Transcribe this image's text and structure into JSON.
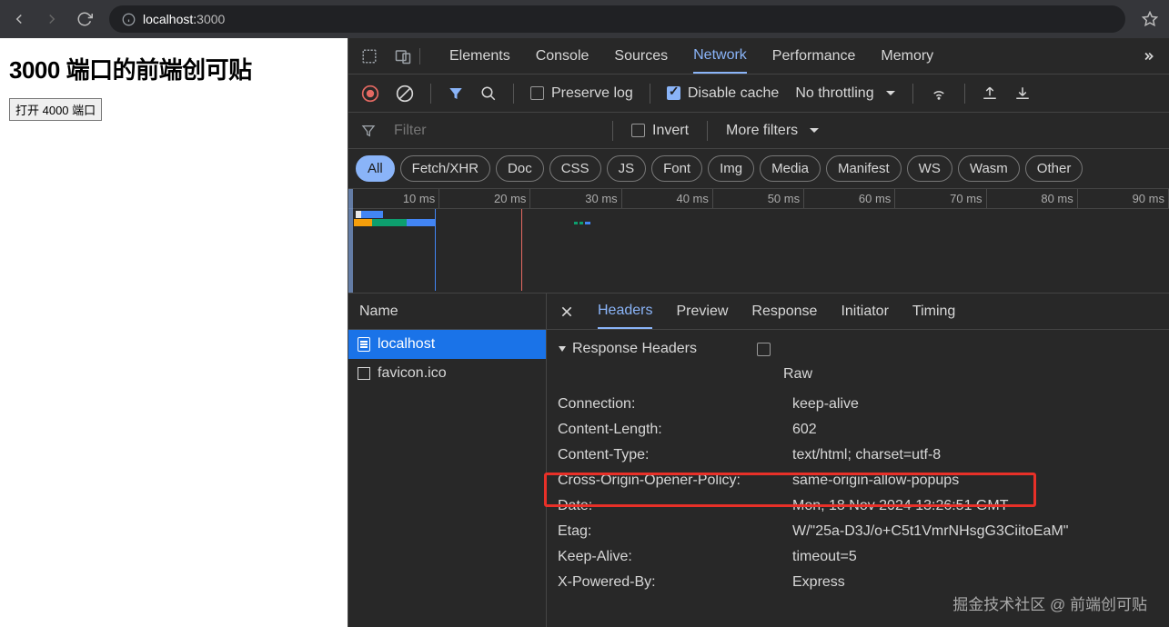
{
  "browser": {
    "url_host": "localhost:",
    "url_port": "3000"
  },
  "page": {
    "title": "3000 端口的前端创可贴",
    "button": "打开 4000 端口"
  },
  "devtools": {
    "tabs": {
      "elements": "Elements",
      "console": "Console",
      "sources": "Sources",
      "network": "Network",
      "performance": "Performance",
      "memory": "Memory"
    },
    "toolbar": {
      "preserve": "Preserve log",
      "disable_cache": "Disable cache",
      "throttle": "No throttling"
    },
    "filter": {
      "placeholder": "Filter",
      "invert": "Invert",
      "more": "More filters"
    },
    "types": [
      "All",
      "Fetch/XHR",
      "Doc",
      "CSS",
      "JS",
      "Font",
      "Img",
      "Media",
      "Manifest",
      "WS",
      "Wasm",
      "Other"
    ],
    "timeline": [
      "10 ms",
      "20 ms",
      "30 ms",
      "40 ms",
      "50 ms",
      "60 ms",
      "70 ms",
      "80 ms",
      "90 ms"
    ],
    "list": {
      "header": "Name",
      "items": [
        "localhost",
        "favicon.ico"
      ]
    },
    "detail": {
      "tabs": {
        "headers": "Headers",
        "preview": "Preview",
        "response": "Response",
        "initiator": "Initiator",
        "timing": "Timing"
      },
      "section": "Response Headers",
      "raw": "Raw",
      "headers": [
        {
          "name": "Connection:",
          "value": "keep-alive"
        },
        {
          "name": "Content-Length:",
          "value": "602"
        },
        {
          "name": "Content-Type:",
          "value": "text/html; charset=utf-8"
        },
        {
          "name": "Cross-Origin-Opener-Policy:",
          "value": "same-origin-allow-popups"
        },
        {
          "name": "Date:",
          "value": "Mon, 18 Nov 2024 13:26:51 GMT"
        },
        {
          "name": "Etag:",
          "value": "W/\"25a-D3J/o+C5t1VmrNHsgG3CiitoEaM\""
        },
        {
          "name": "Keep-Alive:",
          "value": "timeout=5"
        },
        {
          "name": "X-Powered-By:",
          "value": "Express"
        }
      ]
    }
  },
  "watermark": "掘金技术社区 @ 前端创可贴"
}
